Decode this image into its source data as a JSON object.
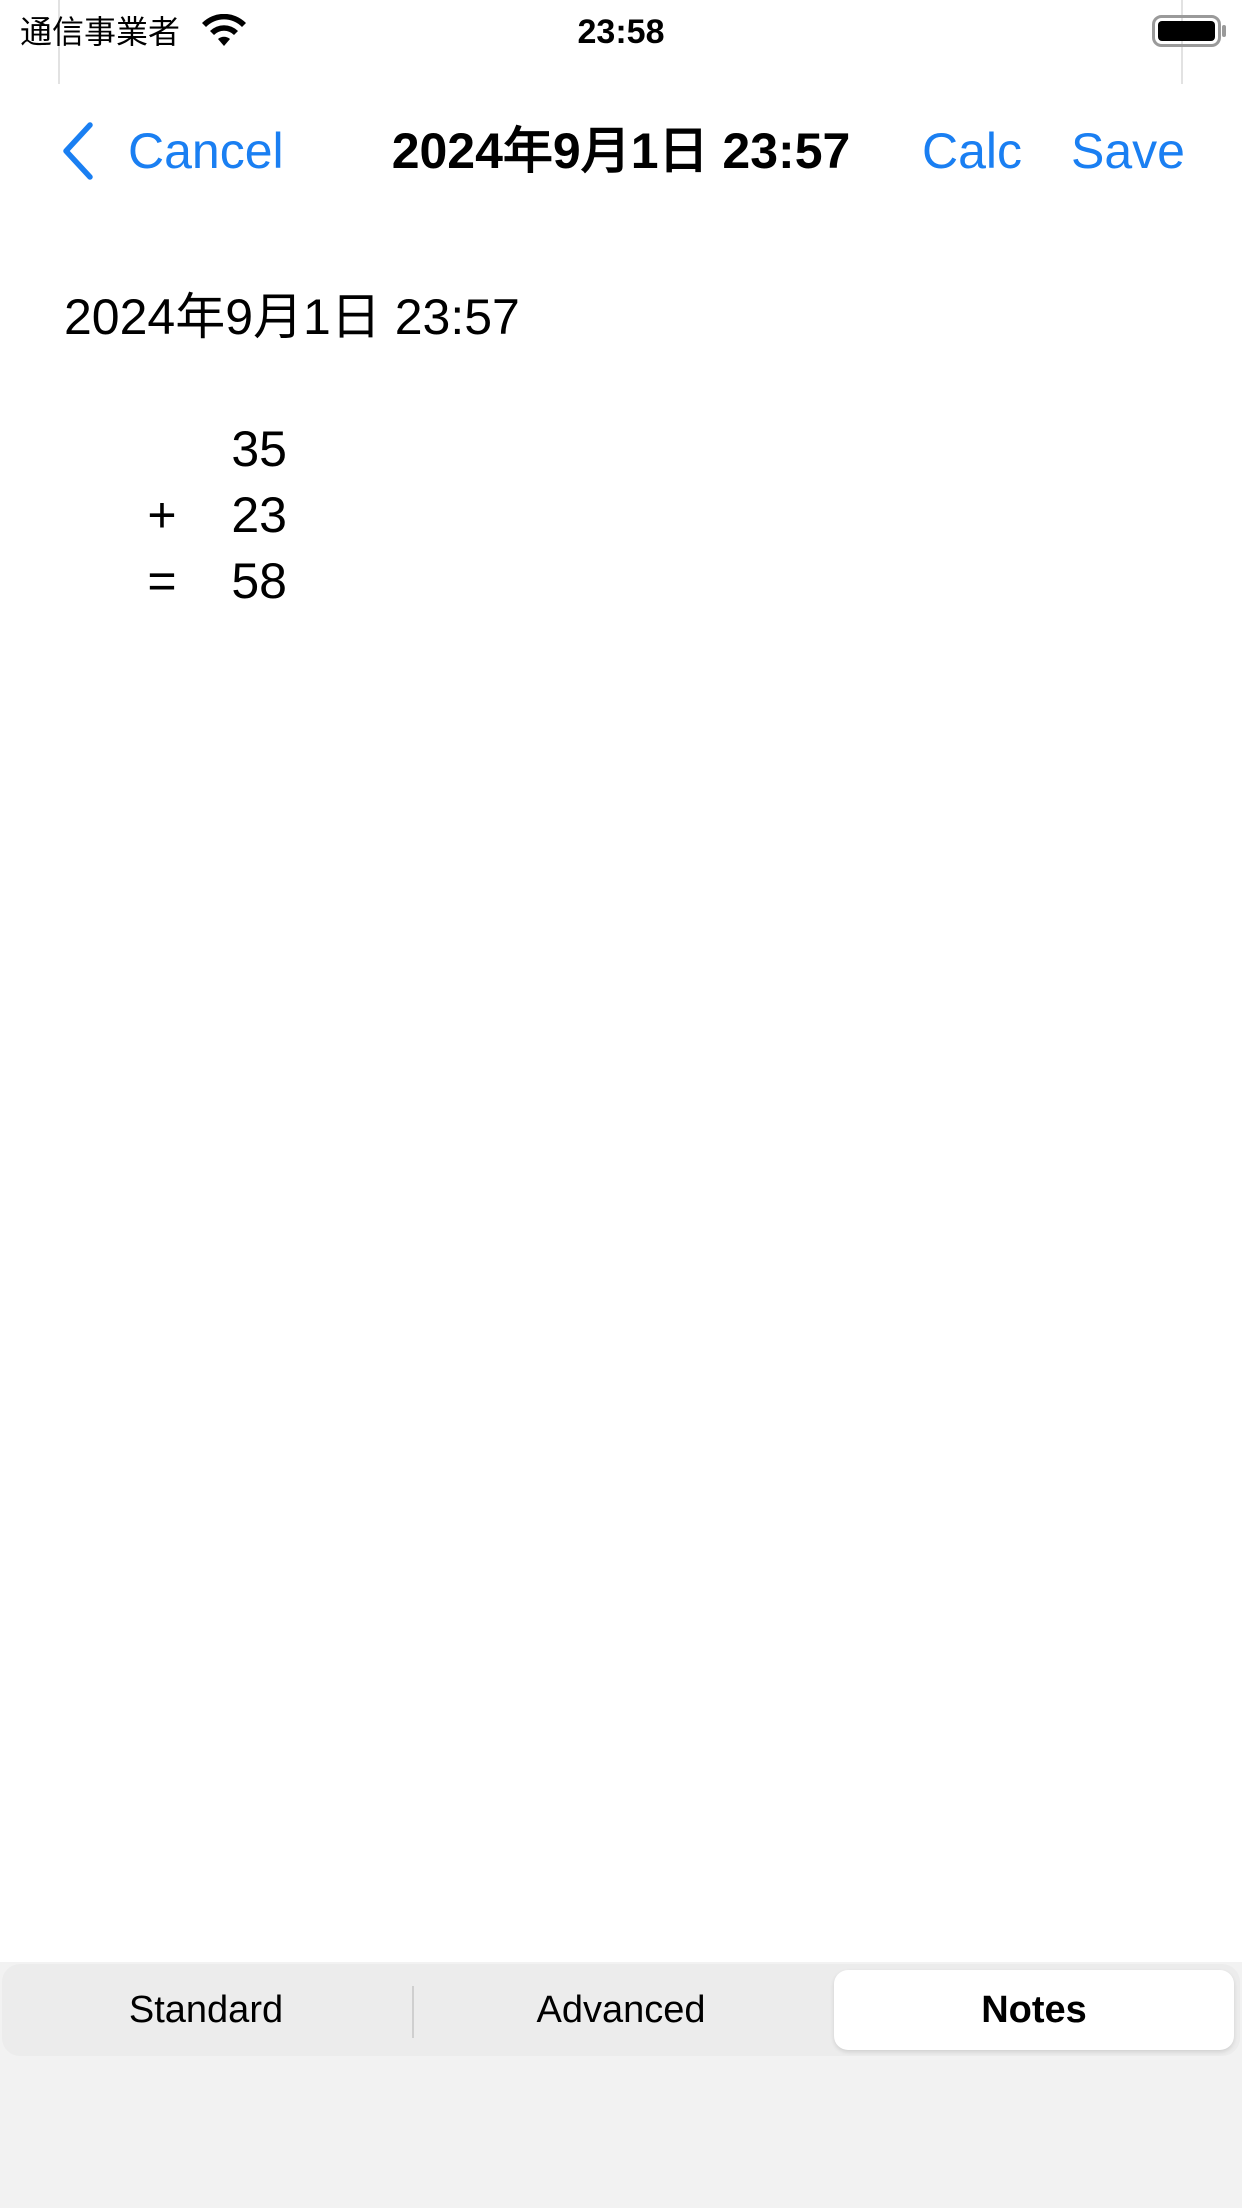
{
  "status_bar": {
    "carrier": "通信事業者",
    "time": "23:58"
  },
  "nav": {
    "cancel_label": "Cancel",
    "title": "2024年9月1日 23:57",
    "calc_label": "Calc",
    "save_label": "Save"
  },
  "note": {
    "header": "2024年9月1日 23:57",
    "lines": [
      {
        "operator": "",
        "value": "35"
      },
      {
        "operator": "+",
        "value": "23"
      },
      {
        "operator": "=",
        "value": "58"
      }
    ]
  },
  "tabs": [
    {
      "label": "Standard",
      "selected": false
    },
    {
      "label": "Advanced",
      "selected": false
    },
    {
      "label": "Notes",
      "selected": true
    }
  ],
  "colors": {
    "accent": "#1a7ff2",
    "background": "#ffffff",
    "segmented_bg": "#ececec"
  },
  "icons": {
    "back": "chevron-left-icon",
    "wifi": "wifi-icon",
    "battery": "battery-icon"
  }
}
